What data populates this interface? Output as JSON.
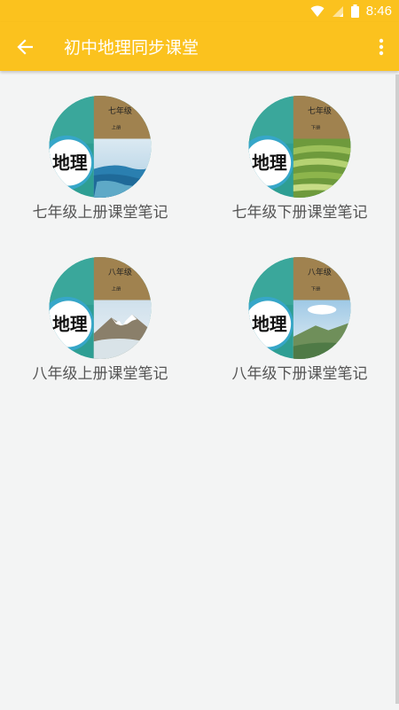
{
  "status_bar": {
    "time": "8:46",
    "icons": [
      "wifi-icon",
      "signal-icon",
      "battery-icon"
    ]
  },
  "app_bar": {
    "title": "初中地理同步课堂",
    "back_icon": "arrow-left-icon",
    "menu_icon": "more-vert-icon",
    "color": "#fbc21e"
  },
  "books": [
    {
      "label": "七年级上册课堂笔记",
      "grade": "七年级",
      "volume": "上册",
      "subject": "地理",
      "scene": "ocean"
    },
    {
      "label": "七年级下册课堂笔记",
      "grade": "七年级",
      "volume": "下册",
      "subject": "地理",
      "scene": "terraces"
    },
    {
      "label": "八年级上册课堂笔记",
      "grade": "八年级",
      "volume": "上册",
      "subject": "地理",
      "scene": "mountain"
    },
    {
      "label": "八年级下册课堂笔记",
      "grade": "八年级",
      "volume": "下册",
      "subject": "地理",
      "scene": "plateau"
    }
  ]
}
